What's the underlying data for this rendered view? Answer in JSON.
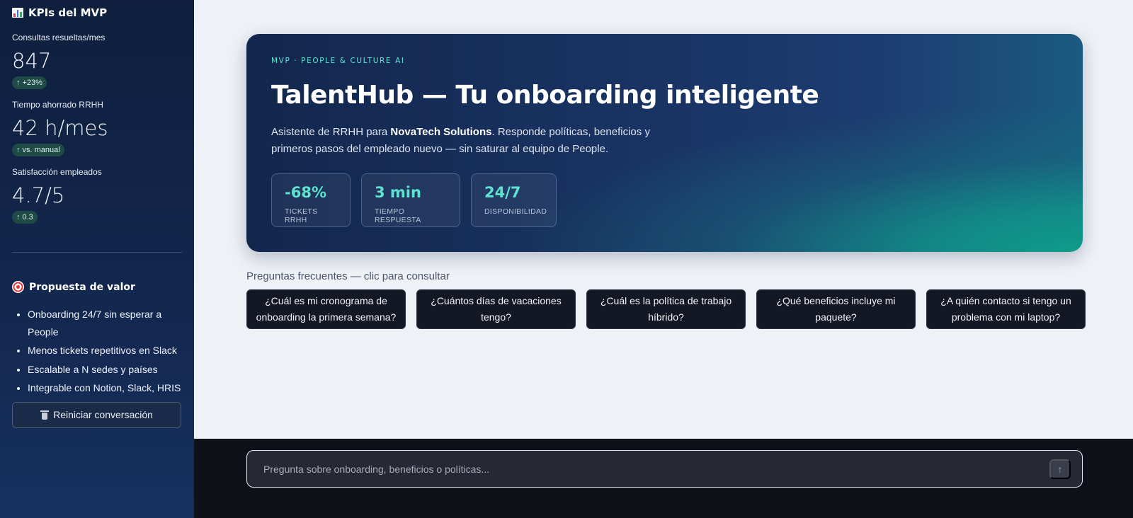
{
  "sidebar": {
    "title": "KPIs del MVP",
    "kpis": [
      {
        "label": "Consultas resueltas/mes",
        "value": "847",
        "delta": "+23%"
      },
      {
        "label": "Tiempo ahorrado RRHH",
        "value": "42 h/mes",
        "delta": "vs. manual"
      },
      {
        "label": "Satisfacción empleados",
        "value": "4.7/5",
        "delta": "0.3"
      }
    ],
    "value_prop": {
      "title": "Propuesta de valor",
      "items": [
        "Onboarding 24/7 sin esperar a People",
        "Menos tickets repetitivos en Slack",
        "Escalable a N sedes y países",
        "Integrable con Notion, Slack, HRIS"
      ]
    },
    "reset_button": "Reiniciar conversación"
  },
  "hero": {
    "kicker": "MVP · PEOPLE & CULTURE AI",
    "title": "TalentHub — Tu onboarding inteligente",
    "desc_prefix": "Asistente de RRHH para ",
    "desc_company": "NovaTech Solutions",
    "desc_suffix": ". Responde políticas, beneficios y primeros pasos del empleado nuevo — sin saturar al equipo de People.",
    "stats": [
      {
        "value": "-68%",
        "label": "TICKETS RRHH"
      },
      {
        "value": "3 min",
        "label": "TIEMPO RESPUESTA"
      },
      {
        "value": "24/7",
        "label": "DISPONIBILIDAD"
      }
    ]
  },
  "faq": {
    "title": "Preguntas frecuentes — clic para consultar",
    "questions": [
      "¿Cuál es mi cronograma de onboarding la primera semana?",
      "¿Cuántos días de vacaciones tengo?",
      "¿Cuál es la política de trabajo híbrido?",
      "¿Qué beneficios incluye mi paquete?",
      "¿A quién contacto si tengo un problema con mi laptop?"
    ]
  },
  "chat": {
    "placeholder": "Pregunta sobre onboarding, beneficios o políticas..."
  },
  "colors": {
    "accent": "#5ee3d0",
    "sidebar_bg": "#0f1f3d",
    "delta_badge": "#1f4a46"
  }
}
